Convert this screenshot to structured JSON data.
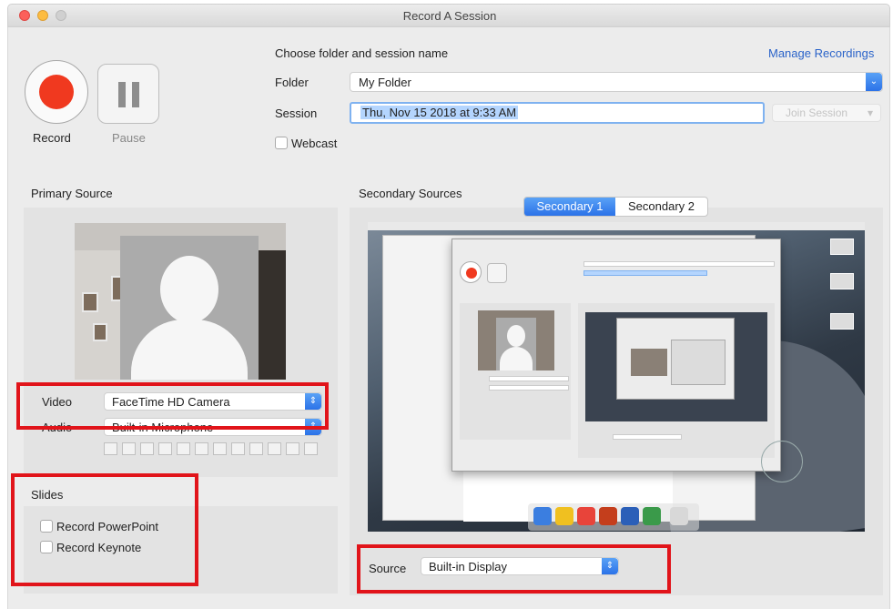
{
  "window": {
    "title": "Record A Session"
  },
  "controls": {
    "record_label": "Record",
    "pause_label": "Pause"
  },
  "session_form": {
    "heading": "Choose folder and session name",
    "manage_link": "Manage Recordings",
    "folder_label": "Folder",
    "folder_value": "My Folder",
    "session_label": "Session",
    "session_value": "Thu, Nov 15 2018 at 9:33 AM",
    "join_button": "Join Session",
    "webcast_label": "Webcast"
  },
  "primary": {
    "title": "Primary Source",
    "video_label": "Video",
    "video_value": "FaceTime HD Camera",
    "audio_label": "Audio",
    "audio_value": "Built-in Microphone"
  },
  "slides": {
    "title": "Slides",
    "options": [
      "Record PowerPoint",
      "Record Keynote"
    ]
  },
  "secondary": {
    "title": "Secondary Sources",
    "tabs": [
      "Secondary 1",
      "Secondary 2"
    ],
    "active_tab": "Secondary 1",
    "source_label": "Source",
    "source_value": "Built-in Display"
  },
  "colors": {
    "accent": "#2b72e8",
    "record_red": "#f0391f",
    "annotation_red": "#e1141a",
    "link": "#2a63c9"
  },
  "icons": [
    "record-icon",
    "pause-icon",
    "stepper-icon",
    "person-placeholder-icon",
    "chevron-down-icon"
  ]
}
